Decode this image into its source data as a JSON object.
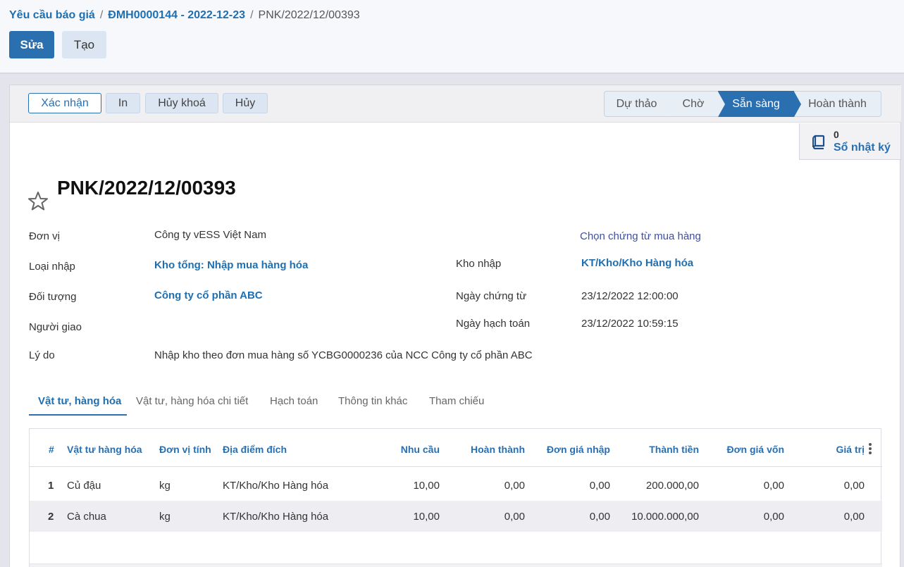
{
  "breadcrumb": {
    "items": [
      "Yêu cầu báo giá",
      "ĐMH0000144 - 2022-12-23"
    ],
    "separator": "/",
    "current": "PNK/2022/12/00393"
  },
  "control_buttons": {
    "edit": "Sửa",
    "create": "Tạo"
  },
  "statusbar": {
    "buttons": [
      "Xác nhận",
      "In",
      "Hủy khoá",
      "Hủy"
    ],
    "stages": [
      "Dự thảo",
      "Chờ",
      "Sẵn sàng",
      "Hoàn thành"
    ],
    "active_stage": "Sẵn sàng"
  },
  "smart_button": {
    "count": "0",
    "label": "Sổ nhật ký",
    "icon": "book-icon"
  },
  "record": {
    "title": "PNK/2022/12/00393",
    "star_icon": "star-outline-icon",
    "fields": {
      "don_vi": {
        "label": "Đơn vị",
        "value": "Công ty vESS Việt Nam"
      },
      "chon_chung_tu": "Chọn chứng từ mua hàng",
      "loai_nhap": {
        "label": "Loại nhập",
        "value": "Kho tổng: Nhập mua hàng hóa"
      },
      "kho_nhap": {
        "label": "Kho nhập",
        "value": "KT/Kho/Kho Hàng hóa"
      },
      "doi_tuong": {
        "label": "Đối tượng",
        "value": "Công ty cổ phần ABC"
      },
      "ngay_chung_tu": {
        "label": "Ngày chứng từ",
        "value": "23/12/2022 12:00:00"
      },
      "nguoi_giao": {
        "label": "Người giao",
        "value": ""
      },
      "ngay_hach_toan": {
        "label": "Ngày hạch toán",
        "value": "23/12/2022 10:59:15"
      },
      "ly_do": {
        "label": "Lý do",
        "value": "Nhập kho theo đơn mua hàng số YCBG0000236 của NCC Công ty cổ phần ABC"
      }
    }
  },
  "tabs": [
    "Vật tư, hàng hóa",
    "Vật tư, hàng hóa chi tiết",
    "Hạch toán",
    "Thông tin khác",
    "Tham chiếu"
  ],
  "active_tab": "Vật tư, hàng hóa",
  "table": {
    "columns": [
      "#",
      "Vật tư hàng hóa",
      "Đơn vị tính",
      "Địa điểm đích",
      "Nhu cầu",
      "Hoàn thành",
      "Đơn giá nhập",
      "Thành tiền",
      "Đơn giá vốn",
      "Giá trị"
    ],
    "rows": [
      [
        "1",
        "Củ đậu",
        "kg",
        "KT/Kho/Kho Hàng hóa",
        "10,00",
        "0,00",
        "0,00",
        "200.000,00",
        "0,00",
        "0,00"
      ],
      [
        "2",
        "Cà chua",
        "kg",
        "KT/Kho/Kho Hàng hóa",
        "10,00",
        "0,00",
        "0,00",
        "10.000.000,00",
        "0,00",
        "0,00"
      ]
    ]
  },
  "colors": {
    "primary": "#2a6fb0",
    "link": "#1f6fb0",
    "stage_active": "#2a6fb0"
  }
}
